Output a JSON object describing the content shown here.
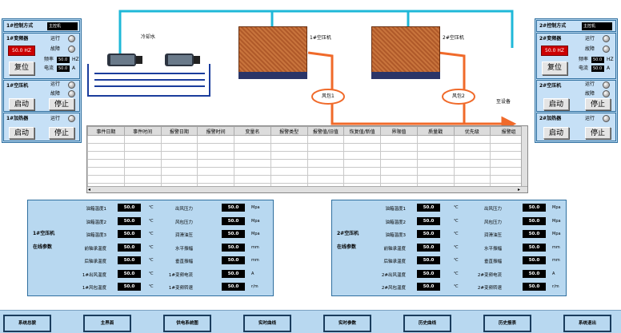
{
  "left": {
    "ctrl_label": "1#控制方式",
    "ctrl_value": "主控机",
    "vfd_label": "1#变频器",
    "running": "运行",
    "fault": "故障",
    "freq_value": "50.0 HZ",
    "freq_label": "频率",
    "current_label": "电流",
    "freq_small": "50.0",
    "freq_unit": "HZ",
    "cur_small": "50.0",
    "cur_unit": "A",
    "reset": "复位",
    "compressor_label": "1#空压机",
    "start": "启动",
    "stop": "停止",
    "dryer_label": "1#加热器"
  },
  "right": {
    "ctrl_label": "2#控制方式",
    "ctrl_value": "主控机",
    "vfd_label": "2#变频器",
    "running": "运行",
    "fault": "故障",
    "freq_value": "50.0 HZ",
    "freq_label": "频率",
    "current_label": "电流",
    "freq_small": "50.0",
    "freq_unit": "HZ",
    "cur_small": "50.0",
    "cur_unit": "A",
    "reset": "复位",
    "compressor_label": "2#空压机",
    "start": "启动",
    "stop": "停止",
    "dryer_label": "2#加热器"
  },
  "process": {
    "water_label": "冷却水",
    "comp1_label": "1#空压机",
    "comp2_label": "2#空压机",
    "fan1_label": "风包1",
    "fan2_label": "风包2",
    "to_equipment": "至设备"
  },
  "alarm_table": {
    "columns": [
      "事件日期",
      "事件时间",
      "报警日期",
      "报警时间",
      "变量名",
      "报警类型",
      "报警值/旧值",
      "恢复值/新值",
      "界限值",
      "质量戳",
      "优先级",
      "报警组"
    ],
    "rows": 7
  },
  "data_left": {
    "title1": "1#空压机",
    "title2": "在线参数",
    "left_rows": [
      {
        "label": "油箱温度1",
        "value": "50.0",
        "unit": "℃"
      },
      {
        "label": "油箱温度2",
        "value": "50.0",
        "unit": "℃"
      },
      {
        "label": "油箱温度3",
        "value": "50.0",
        "unit": "℃"
      },
      {
        "label": "前轴承温度",
        "value": "50.0",
        "unit": "℃"
      },
      {
        "label": "后轴承温度",
        "value": "50.0",
        "unit": "℃"
      },
      {
        "label": "1#出风温度",
        "value": "50.0",
        "unit": "℃"
      },
      {
        "label": "1#风包温度",
        "value": "50.0",
        "unit": "℃"
      }
    ],
    "right_rows": [
      {
        "label": "出风压力",
        "value": "50.0",
        "unit": "Mpa"
      },
      {
        "label": "风包压力",
        "value": "50.0",
        "unit": "Mpa"
      },
      {
        "label": "润滑油压",
        "value": "50.0",
        "unit": "Mpa"
      },
      {
        "label": "水平振幅",
        "value": "50.0",
        "unit": "mm"
      },
      {
        "label": "垂直振幅",
        "value": "50.0",
        "unit": "mm"
      },
      {
        "label": "1#变频电流",
        "value": "50.0",
        "unit": "A"
      },
      {
        "label": "1#变频转速",
        "value": "50.0",
        "unit": "r/m"
      }
    ]
  },
  "data_right": {
    "title1": "2#空压机",
    "title2": "在线参数",
    "left_rows": [
      {
        "label": "油箱温度1",
        "value": "50.0",
        "unit": "℃"
      },
      {
        "label": "油箱温度2",
        "value": "50.0",
        "unit": "℃"
      },
      {
        "label": "油箱温度3",
        "value": "50.0",
        "unit": "℃"
      },
      {
        "label": "前轴承温度",
        "value": "50.0",
        "unit": "℃"
      },
      {
        "label": "后轴承温度",
        "value": "50.0",
        "unit": "℃"
      },
      {
        "label": "2#出风温度",
        "value": "50.0",
        "unit": "℃"
      },
      {
        "label": "2#风包温度",
        "value": "50.0",
        "unit": "℃"
      }
    ],
    "right_rows": [
      {
        "label": "出风压力",
        "value": "50.0",
        "unit": "Mpa"
      },
      {
        "label": "风包压力",
        "value": "50.0",
        "unit": "Mpa"
      },
      {
        "label": "润滑油压",
        "value": "50.0",
        "unit": "Mpa"
      },
      {
        "label": "水平振幅",
        "value": "50.0",
        "unit": "mm"
      },
      {
        "label": "垂直振幅",
        "value": "50.0",
        "unit": "mm"
      },
      {
        "label": "2#变频电流",
        "value": "50.0",
        "unit": "A"
      },
      {
        "label": "2#变频转速",
        "value": "50.0",
        "unit": "r/m"
      }
    ]
  },
  "nav": [
    "系统总貌",
    "主界面",
    "供电系统图",
    "实时曲线",
    "实时参数",
    "历史曲线",
    "历史报表",
    "系统退出"
  ],
  "colors": {
    "panel": "#b8d8f0",
    "pipe_cyan": "#1fb8d8",
    "pipe_orange": "#f06a2a",
    "led_gray": "#bbbbbb"
  }
}
